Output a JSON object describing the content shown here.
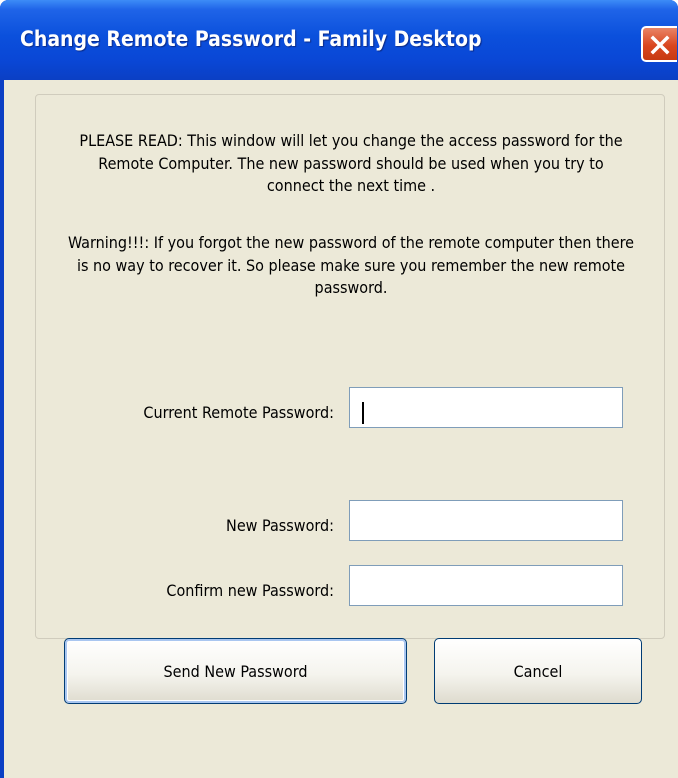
{
  "window": {
    "title": "Change Remote Password - Family Desktop"
  },
  "notice": {
    "paragraph1": "PLEASE READ: This window will let you change the access password for the Remote Computer. The new password should be used when you try to connect the next time .",
    "paragraph2": "Warning!!!: If you forgot the new password of the remote computer then there is no way to recover it. So please make sure you remember the new remote password."
  },
  "form": {
    "current_label": "Current Remote Password:",
    "current_value": "",
    "new_label": "New Password:",
    "new_value": "",
    "confirm_label": "Confirm new Password:",
    "confirm_value": ""
  },
  "buttons": {
    "send_label": "Send New Password",
    "cancel_label": "Cancel"
  },
  "icons": {
    "close": "close-icon"
  },
  "colors": {
    "titlebar": "#0b50dc",
    "close_button": "#d9461f",
    "dialog_background": "#ece9d8"
  }
}
